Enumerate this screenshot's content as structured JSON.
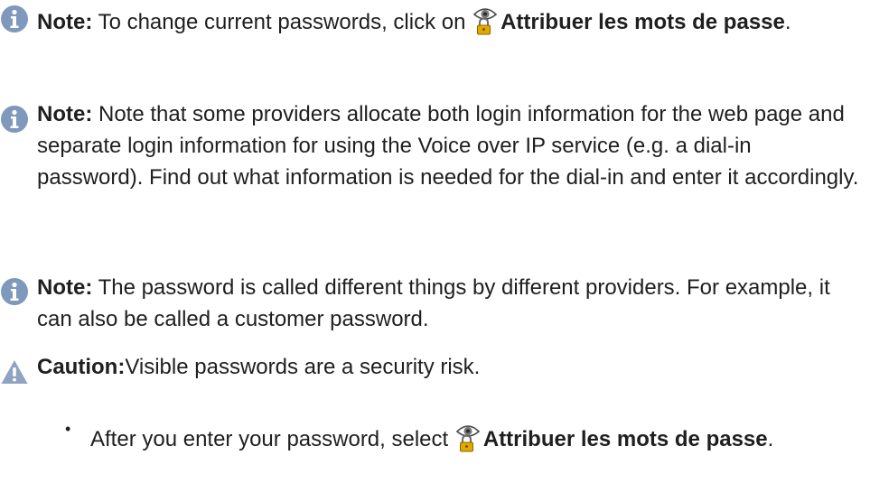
{
  "notes": [
    {
      "icon": "info-icon",
      "label": "Note:",
      "text_before": " To change current passwords, click on ",
      "link_icon": "password-visibility-icon",
      "link": "Attribuer les mots de passe",
      "text_after": "."
    },
    {
      "icon": "info-icon",
      "label": "Note:",
      "text": " Note that some providers allocate both login information for the web page and separate login information for using the Voice over IP service (e.g. a dial-in password). Find out what information is needed for the dial-in and enter it accordingly."
    },
    {
      "icon": "info-icon",
      "label": "Note:",
      "text": " The password is called different things by different providers. For example, it can also be called a customer password."
    }
  ],
  "caution": {
    "icon": "warning-icon",
    "label": "Caution:",
    "text": "Visible passwords are a security risk."
  },
  "bullet_item": {
    "bullet": "•",
    "text_before": "After you enter your password, select ",
    "link_icon": "password-visibility-icon",
    "link": "Attribuer les mots de passe",
    "text_after": "."
  },
  "colors": {
    "info_icon": "#7f98bd",
    "warning_icon": "#8fa3c2",
    "text": "#1f1f1f"
  }
}
